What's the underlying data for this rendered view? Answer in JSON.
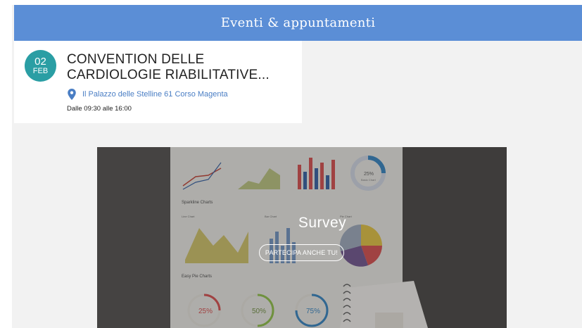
{
  "header": {
    "title": "Eventi & appuntamenti"
  },
  "event": {
    "day": "02",
    "month": "FEB",
    "title": "CONVENTION DELLE CARDIOLOGIE RIABILITATIVE...",
    "location": "Il Palazzo delle Stelline 61 Corso Magenta",
    "time": "Dalle 09:30 alle 16:00"
  },
  "banner": {
    "title": "Survey",
    "cta": "PARTECIPA ANCHE TU!",
    "image_text": {
      "sparkline": "Sparkline Charts",
      "line": "Line Chart",
      "bar": "Bar Chart",
      "pie": "Pie Chart",
      "easy_pie": "Easy Pie Charts",
      "donut_value": "25%",
      "donut_label": "Basic Chart",
      "pie1": "25%",
      "pie2": "50%",
      "pie3": "75%"
    }
  },
  "colors": {
    "header_bg": "#5b8ed6",
    "badge_bg": "#2a9ea4",
    "link": "#4a7ec4"
  }
}
